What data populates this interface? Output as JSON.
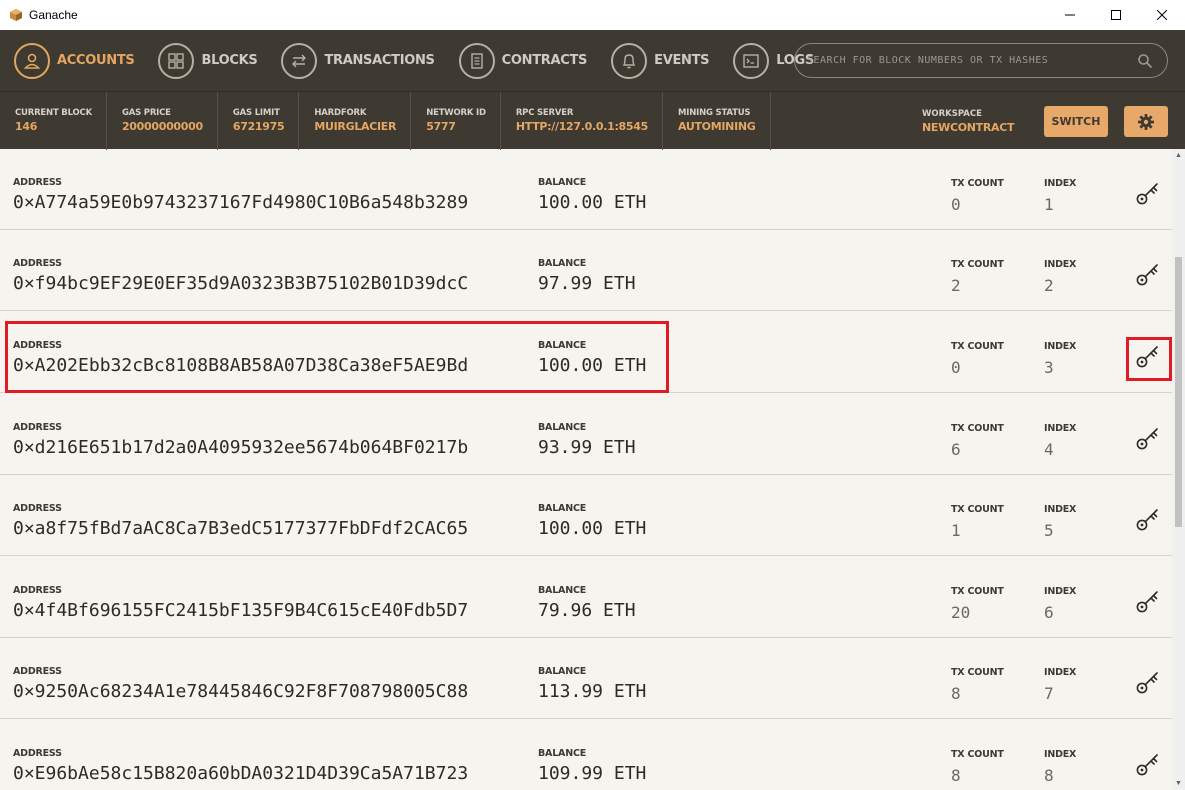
{
  "window": {
    "title": "Ganache"
  },
  "nav": {
    "items": [
      {
        "label": "ACCOUNTS",
        "active": true
      },
      {
        "label": "BLOCKS",
        "active": false
      },
      {
        "label": "TRANSACTIONS",
        "active": false
      },
      {
        "label": "CONTRACTS",
        "active": false
      },
      {
        "label": "EVENTS",
        "active": false
      },
      {
        "label": "LOGS",
        "active": false
      }
    ],
    "search_placeholder": "SEARCH FOR BLOCK NUMBERS OR TX HASHES"
  },
  "status": {
    "items": [
      {
        "key": "CURRENT BLOCK",
        "value": "146"
      },
      {
        "key": "GAS PRICE",
        "value": "20000000000"
      },
      {
        "key": "GAS LIMIT",
        "value": "6721975"
      },
      {
        "key": "HARDFORK",
        "value": "MUIRGLACIER"
      },
      {
        "key": "NETWORK ID",
        "value": "5777"
      },
      {
        "key": "RPC SERVER",
        "value": "HTTP://127.0.0.1:8545"
      },
      {
        "key": "MINING STATUS",
        "value": "AUTOMINING"
      }
    ],
    "workspace_key": "WORKSPACE",
    "workspace_value": "NEWCONTRACT",
    "switch_label": "SWITCH"
  },
  "labels": {
    "address": "ADDRESS",
    "balance": "BALANCE",
    "tx_count": "TX COUNT",
    "index": "INDEX"
  },
  "accounts": [
    {
      "address": "0×A774a59E0b9743237167Fd4980C10B6a548b3289",
      "balance": "100.00 ETH",
      "tx_count": "0",
      "index": "1"
    },
    {
      "address": "0×f94bc9EF29E0EF35d9A0323B3B75102B01D39dcC",
      "balance": "97.99 ETH",
      "tx_count": "2",
      "index": "2"
    },
    {
      "address": "0×A202Ebb32cBc8108B8AB58A07D38Ca38eF5AE9Bd",
      "balance": "100.00 ETH",
      "tx_count": "0",
      "index": "3"
    },
    {
      "address": "0×d216E651b17d2a0A4095932ee5674b064BF0217b",
      "balance": "93.99 ETH",
      "tx_count": "6",
      "index": "4"
    },
    {
      "address": "0×a8f75fBd7aAC8Ca7B3edC5177377FbDFdf2CAC65",
      "balance": "100.00 ETH",
      "tx_count": "1",
      "index": "5"
    },
    {
      "address": "0×4f4Bf696155FC2415bF135F9B4C615cE40Fdb5D7",
      "balance": "79.96 ETH",
      "tx_count": "20",
      "index": "6"
    },
    {
      "address": "0×9250Ac68234A1e78445846C92F8F708798005C88",
      "balance": "113.99 ETH",
      "tx_count": "8",
      "index": "7"
    },
    {
      "address": "0×E96bAe58c15B820a60bDA0321D4D39Ca5A71B723",
      "balance": "109.99 ETH",
      "tx_count": "8",
      "index": "8"
    }
  ],
  "colors": {
    "accent": "#e4a663",
    "header_bg": "#3e3931",
    "content_bg": "#f6f4ef",
    "highlight": "#e01b24"
  }
}
